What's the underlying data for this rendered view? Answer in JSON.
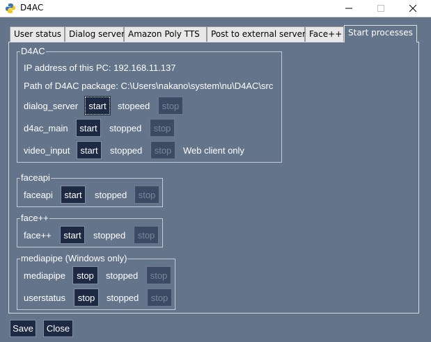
{
  "window": {
    "title": "D4AC"
  },
  "tabs": [
    {
      "label": "User status"
    },
    {
      "label": "Dialog server"
    },
    {
      "label": "Amazon Poly TTS"
    },
    {
      "label": "Post to external server"
    },
    {
      "label": "Face++"
    },
    {
      "label": "Start processes"
    }
  ],
  "d4ac": {
    "group_label": "D4AC",
    "ip_text": "IP address of this PC: 192.168.11.137",
    "path_text": "Path of D4AC package: C:\\Users\\nakano\\system\\nu\\D4AC\\src",
    "rows": [
      {
        "name": "dialog_server",
        "start": "start",
        "status": "stopeed",
        "stop": "stop",
        "note": ""
      },
      {
        "name": "d4ac_main",
        "start": "start",
        "status": "stopped",
        "stop": "stop",
        "note": ""
      },
      {
        "name": "video_input",
        "start": "start",
        "status": "stopped",
        "stop": "stop",
        "note": "Web client only"
      }
    ]
  },
  "faceapi": {
    "group_label": "faceapi",
    "row": {
      "name": "faceapi",
      "start": "start",
      "status": "stopped",
      "stop": "stop"
    }
  },
  "facepp": {
    "group_label": "face++",
    "row": {
      "name": "face++",
      "start": "start",
      "status": "stopped",
      "stop": "stop"
    }
  },
  "mediapipe": {
    "group_label": "mediapipe (Windows only)",
    "rows": [
      {
        "name": "mediapipe",
        "start": "stop",
        "status": "stopped",
        "stop": "stop"
      },
      {
        "name": "userstatus",
        "start": "stop",
        "status": "stopped",
        "stop": "stop"
      }
    ]
  },
  "footer": {
    "save": "Save",
    "close": "Close"
  }
}
